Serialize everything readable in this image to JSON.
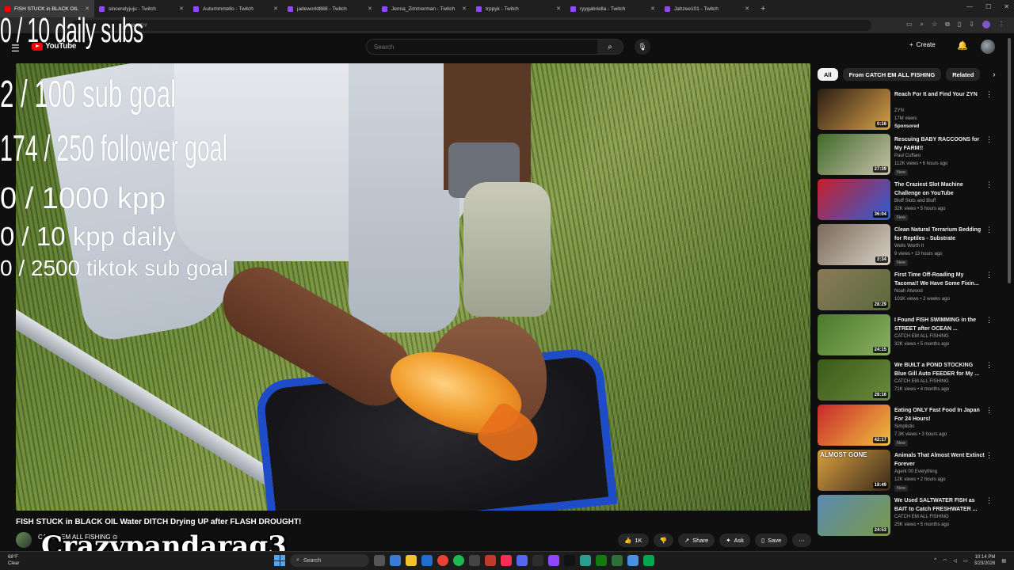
{
  "browser": {
    "tabs": [
      {
        "label": "FISH STUCK in BLACK OIL"
      },
      {
        "label": "sincerelyjuju - Twitch"
      },
      {
        "label": "Autummmello - Twitch"
      },
      {
        "label": "jadeworld888 - Twitch"
      },
      {
        "label": "Jenna_Zimmerman - Twitch"
      },
      {
        "label": "trppyk - Twitch"
      },
      {
        "label": "ryygabriella - Twitch"
      },
      {
        "label": "Jahzee101 - Twitch"
      }
    ],
    "url_fragment": "2_du4M3DY"
  },
  "youtube": {
    "logo_text": "YouTube",
    "search_placeholder": "Search",
    "create_label": "Create"
  },
  "overlay": {
    "line1": "0 / 10 daily subs",
    "line2": "2 / 100 sub goal",
    "line3": "174 / 250 follower goal",
    "line4": "0 / 1000 kpp",
    "line5": "0 / 10 kpp daily",
    "line6": "0 / 2500 tiktok sub goal",
    "username": "Crazypandarag3"
  },
  "video": {
    "title": "FISH STUCK in BLACK OIL Water DITCH Drying UP after FLASH DROUGHT!",
    "channel": "CATCH EM ALL FISHING",
    "like_count": "1K",
    "share_label": "Share",
    "ask_label": "Ask",
    "save_label": "Save"
  },
  "sidebar": {
    "chips": [
      "All",
      "From CATCH EM ALL FISHING",
      "Related"
    ],
    "recommendations": [
      {
        "title": "Reach For It and Find Your ZYN",
        "channel": "ZYN",
        "meta": "17M views",
        "badge": "Sponsored",
        "duration": "0:16",
        "thumb_a": "#2a1d14",
        "thumb_b": "#d9a04a"
      },
      {
        "title": "Rescuing BABY RACCOONS for My FARM!!",
        "channel": "Paul Cuffaro",
        "meta": "112K views • 6 hours ago",
        "badge": "New",
        "duration": "27:39",
        "thumb_a": "#3f6a2a",
        "thumb_b": "#c8c0a8"
      },
      {
        "title": "The Craziest Slot Machine Challenge on YouTube",
        "channel": "Bluff Slots and Bluff",
        "meta": "32K views • 5 hours ago",
        "badge": "New",
        "duration": "36:04",
        "thumb_a": "#c81e2a",
        "thumb_b": "#2c5fd8"
      },
      {
        "title": "Clean Natural Terrarium Bedding for Reptiles - Substrate",
        "channel": "Wells Worth It",
        "meta": "9 views • 13 hours ago",
        "badge": "New",
        "duration": "2:34",
        "thumb_a": "#7a6a5a",
        "thumb_b": "#d8d0c4"
      },
      {
        "title": "First Time Off-Roading My Tacoma!! We Have Some Fixin...",
        "channel": "Noah Atwood",
        "meta": "101K views • 2 weeks ago",
        "badge": "",
        "duration": "28:29",
        "thumb_a": "#8a7a5a",
        "thumb_b": "#5a6a3a"
      },
      {
        "title": "I Found FISH SWIMMING in the STREET after OCEAN ...",
        "channel": "CATCH EM ALL FISHING",
        "meta": "32K views • 5 months ago",
        "badge": "",
        "duration": "24:15",
        "thumb_a": "#4a7a2a",
        "thumb_b": "#8ab060"
      },
      {
        "title": "We BUILT a POND STOCKING Blue Gill Auto FEEDER for My ...",
        "channel": "CATCH EM ALL FISHING",
        "meta": "71K views • 4 months ago",
        "badge": "",
        "duration": "28:16",
        "thumb_a": "#3a5a1a",
        "thumb_b": "#6a8a3a"
      },
      {
        "title": "Eating ONLY Fast Food In Japan For 24 Hours!",
        "channel": "Simplistic",
        "meta": "7.3K views • 3 hours ago",
        "badge": "New",
        "duration": "42:17",
        "thumb_a": "#c8282a",
        "thumb_b": "#f0c040"
      },
      {
        "title": "Animals That Almost Went Extinct Forever",
        "channel": "Agent 00 Everything",
        "meta": "12K views • 2 hours ago",
        "badge": "New",
        "duration": "18:49",
        "thumb_a": "#d8a040",
        "thumb_b": "#3a2a1a",
        "thumb_text": "ALMOST GONE"
      },
      {
        "title": "We Used SALTWATER FISH as BAIT to Catch FRESHWATER ...",
        "channel": "CATCH EM ALL FISHING",
        "meta": "25K views • 5 months ago",
        "badge": "",
        "duration": "24:53",
        "thumb_a": "#5a8ab0",
        "thumb_b": "#7a9a4a"
      }
    ]
  },
  "taskbar": {
    "weather_temp": "68°F",
    "weather_desc": "Clear",
    "search_label": "Search",
    "time": "10:14 PM",
    "date": "3/23/2026"
  },
  "colors": {
    "accent": "#ff0000",
    "twitch": "#9146ff",
    "net": "#1e4cc8"
  }
}
